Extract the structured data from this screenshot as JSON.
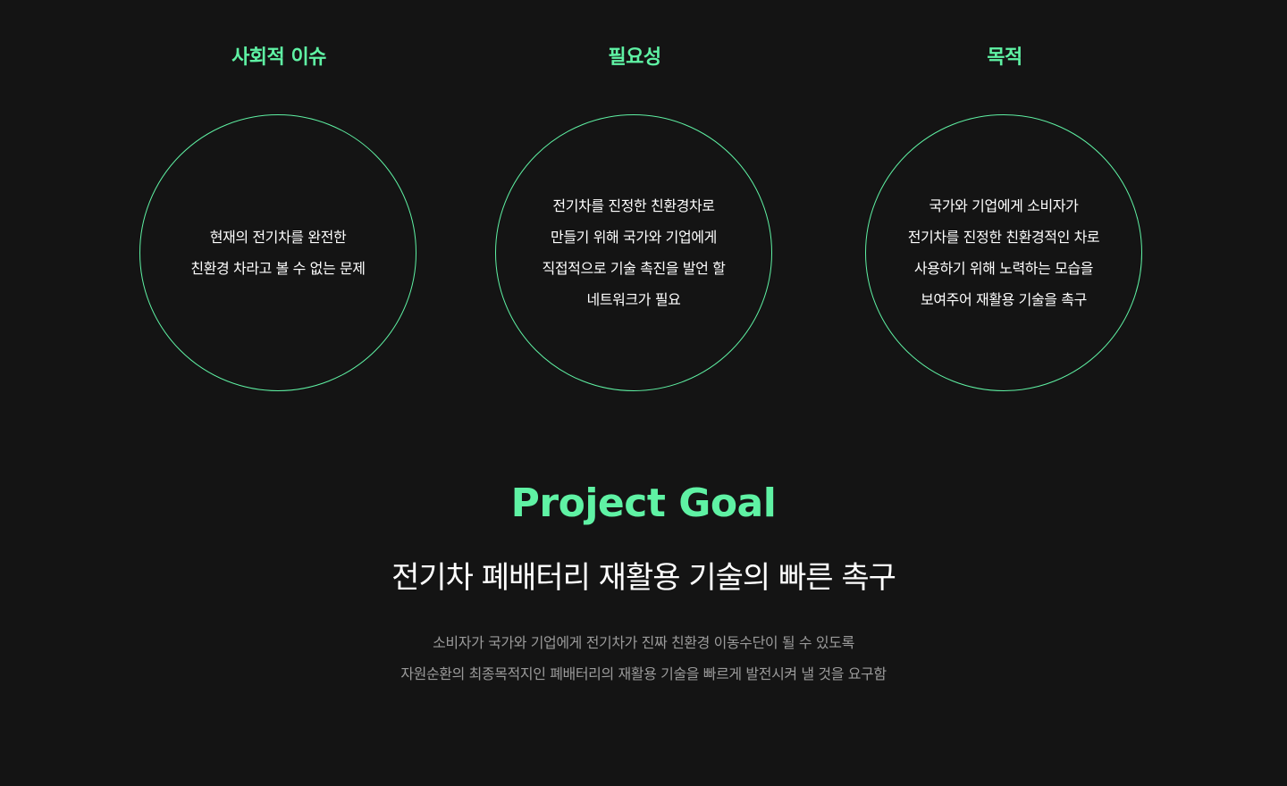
{
  "columns": [
    {
      "title": "사회적 이슈",
      "lines": [
        "현재의 전기차를 완전한",
        "친환경 차라고 볼 수 없는 문제"
      ]
    },
    {
      "title": "필요성",
      "lines": [
        "전기차를 진정한 친환경차로",
        "만들기 위해 국가와 기업에게",
        "직접적으로 기술 촉진을 발언 할",
        "네트워크가 필요"
      ]
    },
    {
      "title": "목적",
      "lines": [
        "국가와 기업에게 소비자가",
        "전기차를 진정한 친환경적인 차로",
        "사용하기 위해 노력하는 모습을",
        "보여주어 재활용 기술을 촉구"
      ]
    }
  ],
  "goal": {
    "title": "Project Goal",
    "subtitle": "전기차 폐배터리 재활용 기술의 빠른 촉구",
    "description": [
      "소비자가 국가와 기업에게 전기차가 진짜 친환경 이동수단이 될 수 있도록",
      "자원순환의 최종목적지인 폐배터리의 재활용 기술을 빠르게 발전시켜 낼 것을 요구함"
    ]
  },
  "colors": {
    "background": "#141414",
    "accent": "#5ff2a4",
    "text": "#ffffff",
    "muted": "#9a9a9a"
  }
}
